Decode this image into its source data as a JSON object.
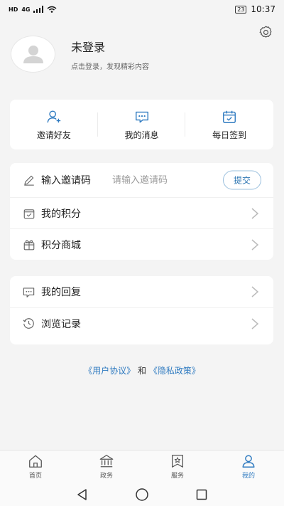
{
  "status": {
    "left_badge": "HD",
    "network": "4G",
    "battery": "23",
    "time": "10:37"
  },
  "profile": {
    "name": "未登录",
    "subtitle": "点击登录，发现精彩内容"
  },
  "quick_actions": [
    {
      "label": "邀请好友",
      "icon": "invite-friend-icon"
    },
    {
      "label": "我的消息",
      "icon": "message-icon"
    },
    {
      "label": "每日签到",
      "icon": "calendar-check-icon"
    }
  ],
  "invite": {
    "label": "输入邀请码",
    "placeholder": "请输入邀请码",
    "submit_label": "提交"
  },
  "menu_group1": [
    {
      "label": "我的积分",
      "icon": "points-icon"
    },
    {
      "label": "积分商城",
      "icon": "gift-box-icon"
    }
  ],
  "menu_group2": [
    {
      "label": "我的回复",
      "icon": "reply-icon"
    },
    {
      "label": "浏览记录",
      "icon": "history-icon"
    }
  ],
  "legal": {
    "user_agreement": "《用户协议》",
    "connector": "和",
    "privacy_policy": "《隐私政策》"
  },
  "tabs": [
    {
      "label": "首页",
      "icon": "home-icon"
    },
    {
      "label": "政务",
      "icon": "government-icon"
    },
    {
      "label": "服务",
      "icon": "service-icon"
    },
    {
      "label": "我的",
      "icon": "user-icon",
      "active": true
    }
  ],
  "colors": {
    "accent": "#2e7ac0",
    "page_bg": "#f4f4f4",
    "card_bg": "#ffffff"
  }
}
